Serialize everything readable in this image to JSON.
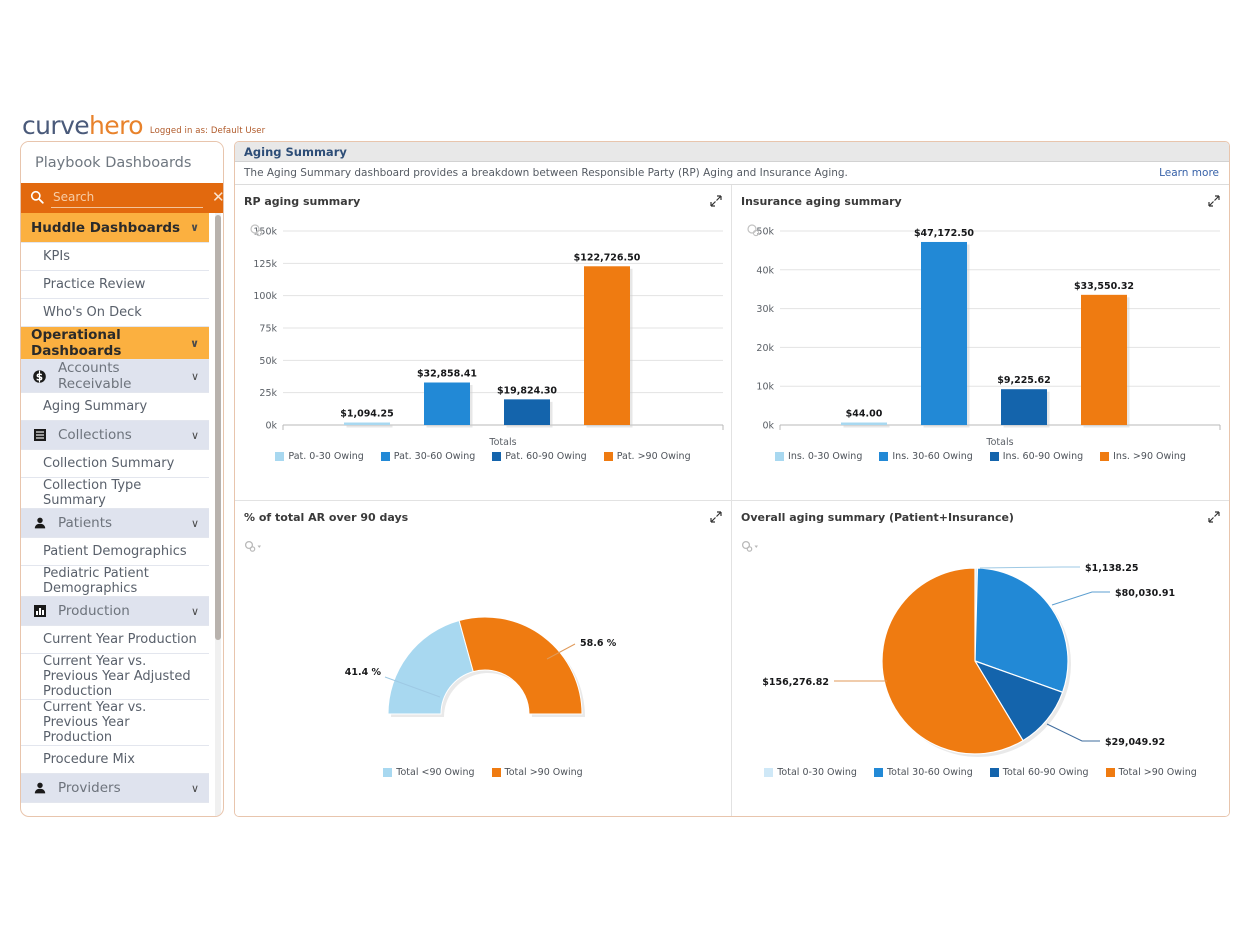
{
  "brand": {
    "logo_first": "curve",
    "logo_second": "hero",
    "logged_in_as": "Logged in as: Default User"
  },
  "sidebar": {
    "title": "Playbook Dashboards",
    "search": {
      "value": "",
      "placeholder": "Search",
      "clear_label": "✕"
    },
    "items": [
      {
        "label": "Huddle Dashboards",
        "type": "group-major",
        "icon": "",
        "chevron": "∨"
      },
      {
        "label": "KPIs",
        "type": "leaf"
      },
      {
        "label": "Practice Review",
        "type": "leaf"
      },
      {
        "label": "Who's On Deck",
        "type": "leaf"
      },
      {
        "label": "Operational Dashboards",
        "type": "group-major",
        "chevron": "∨"
      },
      {
        "label": "Accounts Receivable",
        "type": "group",
        "icon": "dollar-circle-icon",
        "chevron": "∨"
      },
      {
        "label": "Aging Summary",
        "type": "leaf"
      },
      {
        "label": "Collections",
        "type": "group",
        "icon": "list-icon",
        "chevron": "∨"
      },
      {
        "label": "Collection Summary",
        "type": "leaf"
      },
      {
        "label": "Collection Type Summary",
        "type": "leaf"
      },
      {
        "label": "Patients",
        "type": "group",
        "icon": "person-icon",
        "chevron": "∨"
      },
      {
        "label": "Patient Demographics",
        "type": "leaf"
      },
      {
        "label": "Pediatric Patient Demographics",
        "type": "leaf"
      },
      {
        "label": "Production",
        "type": "group",
        "icon": "bar-chart-icon",
        "chevron": "∨"
      },
      {
        "label": "Current Year Production",
        "type": "leaf"
      },
      {
        "label": "Current Year vs. Previous Year Adjusted Production",
        "type": "leaf"
      },
      {
        "label": "Current Year vs. Previous Year Production",
        "type": "leaf"
      },
      {
        "label": "Procedure Mix",
        "type": "leaf"
      },
      {
        "label": "Providers",
        "type": "group",
        "icon": "person-icon",
        "chevron": "∨"
      }
    ]
  },
  "main": {
    "title": "Aging Summary",
    "description": "The Aging Summary dashboard provides a breakdown between Responsible Party (RP) Aging and Insurance Aging.",
    "learn_more": "Learn more"
  },
  "colors": {
    "light_blue": "#a8d8f0",
    "blue": "#2289d6",
    "dark_blue": "#1464ac",
    "orange": "#ef7b11",
    "accent_orange": "#e2690e",
    "header_orange": "#fbb040",
    "link_blue": "#3761a8"
  },
  "chart_data": [
    {
      "id": "rp-aging-summary",
      "type": "bar",
      "title": "RP aging summary",
      "xlabel": "Totals",
      "ylabel": "",
      "categories": [
        "Totals"
      ],
      "ylim": [
        0,
        150000
      ],
      "ytick_labels": [
        "0k",
        "25k",
        "50k",
        "75k",
        "100k",
        "125k",
        "150k"
      ],
      "ytick_values": [
        0,
        25000,
        50000,
        75000,
        100000,
        125000,
        150000
      ],
      "grid": true,
      "legend_position": "bottom",
      "series": [
        {
          "name": "Pat. 0-30 Owing",
          "value": 1094.25,
          "label": "$1,094.25",
          "color": "#a8d8f0"
        },
        {
          "name": "Pat. 30-60 Owing",
          "value": 32858.41,
          "label": "$32,858.41",
          "color": "#2289d6"
        },
        {
          "name": "Pat. 60-90 Owing",
          "value": 19824.3,
          "label": "$19,824.30",
          "color": "#1464ac"
        },
        {
          "name": "Pat. >90 Owing",
          "value": 122726.5,
          "label": "$122,726.50",
          "color": "#ef7b11"
        }
      ]
    },
    {
      "id": "insurance-aging-summary",
      "type": "bar",
      "title": "Insurance aging summary",
      "xlabel": "Totals",
      "ylabel": "",
      "categories": [
        "Totals"
      ],
      "ylim": [
        0,
        50000
      ],
      "ytick_labels": [
        "0k",
        "10k",
        "20k",
        "30k",
        "40k",
        "50k"
      ],
      "ytick_values": [
        0,
        10000,
        20000,
        30000,
        40000,
        50000
      ],
      "grid": true,
      "legend_position": "bottom",
      "series": [
        {
          "name": "Ins. 0-30 Owing",
          "value": 44.0,
          "label": "$44.00",
          "color": "#a8d8f0"
        },
        {
          "name": "Ins. 30-60 Owing",
          "value": 47172.5,
          "label": "$47,172.50",
          "color": "#2289d6"
        },
        {
          "name": "Ins. 60-90 Owing",
          "value": 9225.62,
          "label": "$9,225.62",
          "color": "#1464ac"
        },
        {
          "name": "Ins. >90 Owing",
          "value": 33550.32,
          "label": "$33,550.32",
          "color": "#ef7b11"
        }
      ]
    },
    {
      "id": "pct-total-ar-over-90-days",
      "type": "pie",
      "variant": "half-donut",
      "title": "% of total AR over 90 days",
      "legend_position": "bottom",
      "slices": [
        {
          "name": "Total <90 Owing",
          "value": 41.4,
          "label": "41.4 %",
          "color": "#a8d8f0"
        },
        {
          "name": "Total >90 Owing",
          "value": 58.6,
          "label": "58.6 %",
          "color": "#ef7b11"
        }
      ]
    },
    {
      "id": "overall-aging-summary",
      "type": "pie",
      "title": "Overall aging summary (Patient+Insurance)",
      "legend_position": "bottom",
      "slices": [
        {
          "name": "Total 0-30 Owing",
          "value": 1138.25,
          "label": "$1,138.25",
          "color": "#cfe8f7"
        },
        {
          "name": "Total 30-60 Owing",
          "value": 80030.91,
          "label": "$80,030.91",
          "color": "#2289d6"
        },
        {
          "name": "Total 60-90 Owing",
          "value": 29049.92,
          "label": "$29,049.92",
          "color": "#1464ac"
        },
        {
          "name": "Total >90 Owing",
          "value": 156276.82,
          "label": "$156,276.82",
          "color": "#ef7b11"
        }
      ]
    }
  ]
}
